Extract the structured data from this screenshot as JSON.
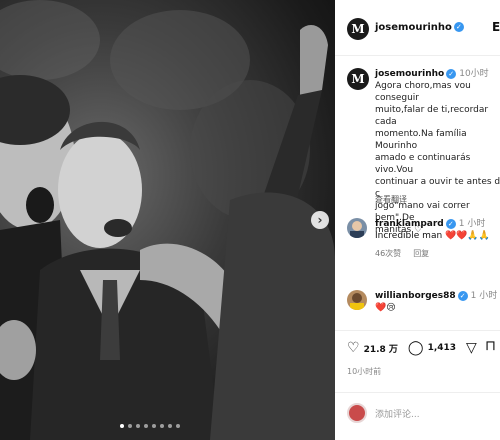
{
  "post": {
    "username": "josemourinho",
    "logo_letter": "M",
    "more_icon": "E",
    "caption_time": "10小时",
    "caption_text": "Agora choro,mas vou conseguir\nmuito,falar de ti,recordar cada\nmomento.Na família Mourinho\namado e continuarás vivo.Vou\ncontinuar a ouvir te antes de c\njogo\"mano vai correr bem\".De\nmanitas ♡",
    "translate_label": "查看翻译"
  },
  "comments": [
    {
      "username": "franklampard",
      "time": "1 小时",
      "text": "Incredible man ❤️❤️🙏🙏",
      "likes": "46次赞",
      "reply": "回复"
    },
    {
      "username": "willianborges88",
      "time": "1 小时",
      "text": "❤️😢"
    }
  ],
  "actions": {
    "likes": "21.8 万",
    "comments": "1,413",
    "post_time": "10小时前"
  },
  "add_comment": {
    "placeholder": "添加评论..."
  },
  "colors": {
    "verified": "#3897f0",
    "heart": "#e0245e"
  },
  "icons": {
    "like": "heart-icon",
    "comment": "comment-icon",
    "share": "share-icon",
    "save": "bookmark-icon",
    "next": "chevron-right-icon"
  }
}
